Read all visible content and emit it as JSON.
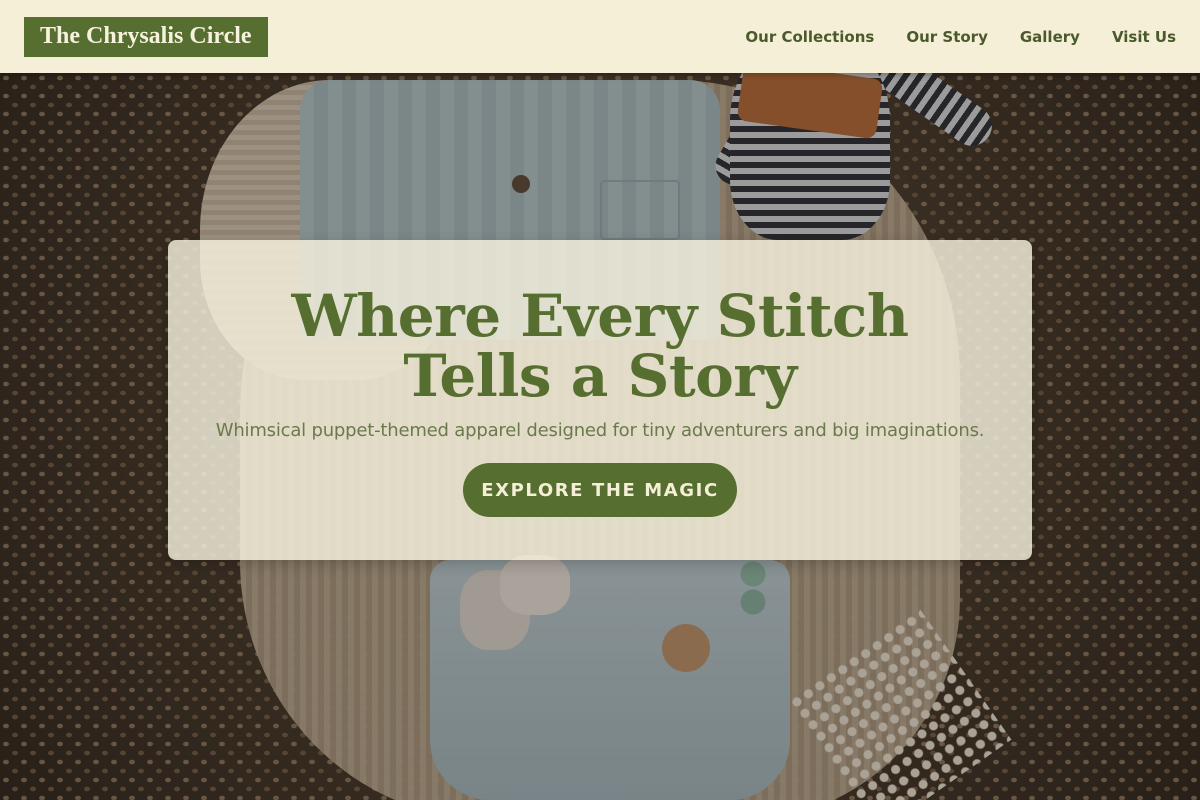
{
  "header": {
    "logo_text": "The Chrysalis Circle",
    "nav": [
      {
        "label": "Our Collections"
      },
      {
        "label": "Our Story"
      },
      {
        "label": "Gallery"
      },
      {
        "label": "Visit Us"
      }
    ]
  },
  "hero": {
    "title": "Where Every Stitch Tells a Story",
    "subtitle": "Whimsical puppet-themed apparel designed for tiny adventurers and big imaginations.",
    "cta_label": "EXPLORE THE MAGIC",
    "background_image": "baby-clothes-flatlay-on-woven-rug"
  },
  "colors": {
    "brand_green": "#566e2f",
    "header_bg": "#f4efd6",
    "card_bg": "#f6f2de"
  }
}
